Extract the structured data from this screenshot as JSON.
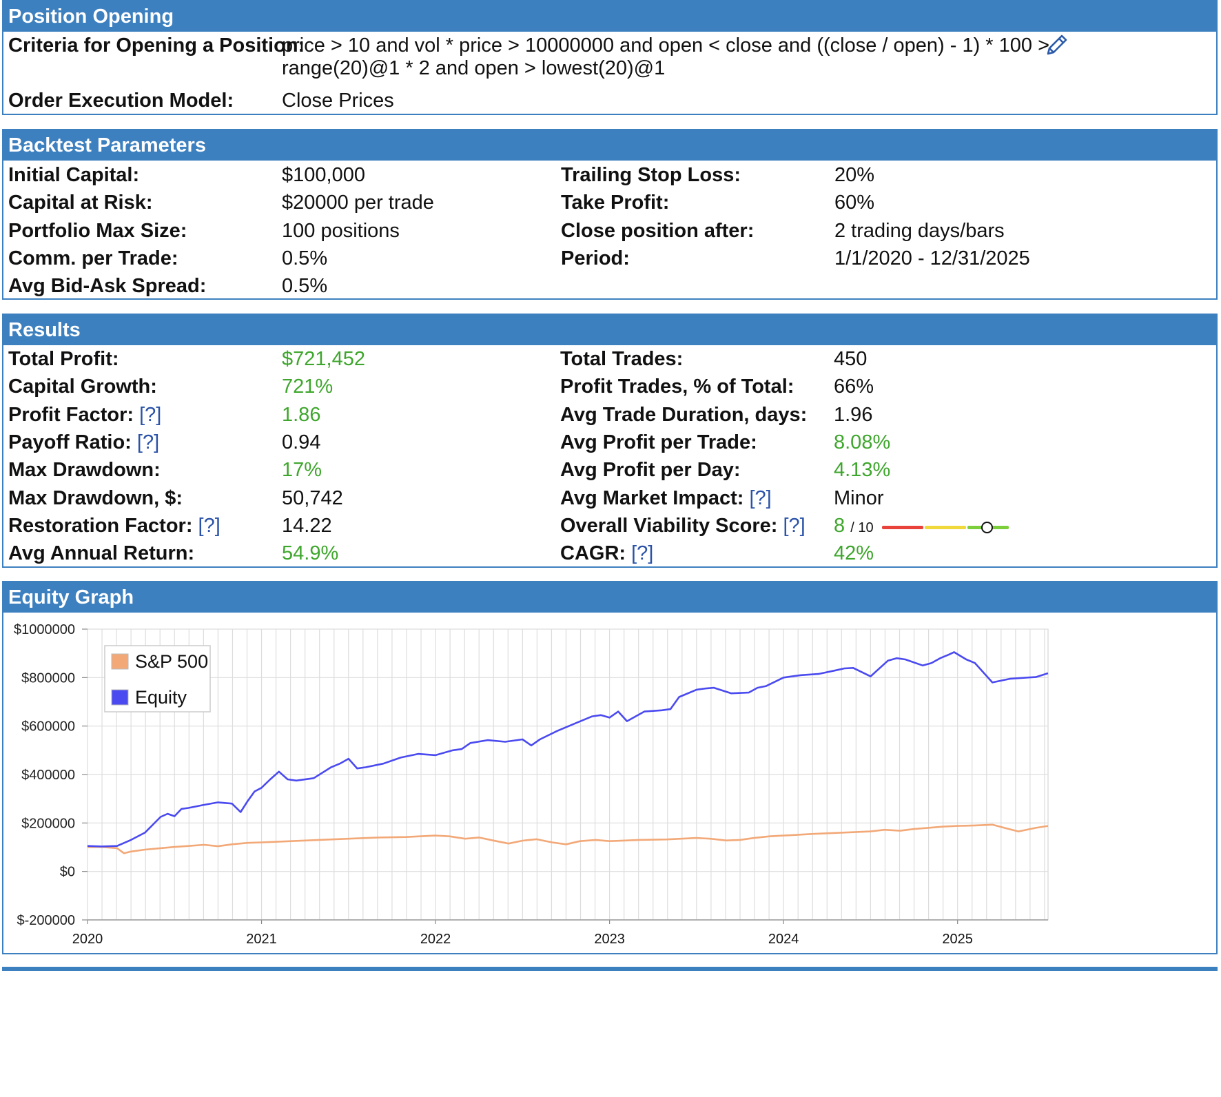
{
  "position_opening": {
    "title": "Position Opening",
    "criteria_label": "Criteria for Opening a Position:",
    "criteria_line1": "price > 10 and vol * price > 10000000 and open < close and ((close / open) - 1) * 100 >",
    "criteria_line2": "range(20)@1 * 2 and open > lowest(20)@1",
    "execution_label": "Order Execution Model:",
    "execution_value": "Close Prices",
    "edit_icon": "pencil-icon"
  },
  "backtest": {
    "title": "Backtest Parameters",
    "left": [
      {
        "label": "Initial Capital:",
        "value": "$100,000"
      },
      {
        "label": "Capital at Risk:",
        "value": "$20000 per trade"
      },
      {
        "label": "Portfolio Max Size:",
        "value": "100 positions"
      },
      {
        "label": "Comm. per Trade:",
        "value": "0.5%"
      },
      {
        "label": "Avg Bid-Ask Spread:",
        "value": "0.5%"
      }
    ],
    "right": [
      {
        "label": "Trailing Stop Loss:",
        "value": "20%"
      },
      {
        "label": "Take Profit:",
        "value": "60%"
      },
      {
        "label": "Close position after:",
        "value": "2 trading days/bars"
      },
      {
        "label": "Period:",
        "value": "1/1/2020 - 12/31/2025"
      }
    ]
  },
  "results": {
    "title": "Results",
    "help_text": "[?]",
    "left": [
      {
        "label": "Total Profit:",
        "value": "$721,452",
        "green": true,
        "help": false
      },
      {
        "label": "Capital Growth:",
        "value": "721%",
        "green": true,
        "help": false
      },
      {
        "label": "Profit Factor:",
        "value": "1.86",
        "green": true,
        "help": true
      },
      {
        "label": "Payoff Ratio:",
        "value": "0.94",
        "green": false,
        "help": true
      },
      {
        "label": "Max Drawdown:",
        "value": "17%",
        "green": true,
        "help": false
      },
      {
        "label": "Max Drawdown, $:",
        "value": "50,742",
        "green": false,
        "help": false
      },
      {
        "label": "Restoration Factor:",
        "value": "14.22",
        "green": false,
        "help": true
      },
      {
        "label": "Avg Annual Return:",
        "value": "54.9%",
        "green": true,
        "help": false
      }
    ],
    "right": [
      {
        "label": "Total Trades:",
        "value": "450",
        "green": false,
        "help": false
      },
      {
        "label": "Profit Trades, % of Total:",
        "value": "66%",
        "green": false,
        "help": false
      },
      {
        "label": "Avg Trade Duration, days:",
        "value": "1.96",
        "green": false,
        "help": false
      },
      {
        "label": "Avg Profit per Trade:",
        "value": "8.08%",
        "green": true,
        "help": false
      },
      {
        "label": "Avg Profit per Day:",
        "value": "4.13%",
        "green": true,
        "help": false
      },
      {
        "label": "Avg Market Impact:",
        "value": "Minor",
        "green": false,
        "help": true
      },
      {
        "label": "Overall Viability Score:",
        "value": "8",
        "green": true,
        "help": true,
        "suffix": "/ 10",
        "score": 8,
        "score_max": 10
      },
      {
        "label": "CAGR:",
        "value": "42%",
        "green": true,
        "help": true
      }
    ],
    "score_colors": [
      "#e8423a",
      "#f0d93a",
      "#7ccf3a"
    ]
  },
  "equity": {
    "title": "Equity Graph"
  },
  "chart_data": {
    "type": "line",
    "title": "",
    "xlabel": "",
    "ylabel": "",
    "ylim": [
      -200000,
      1000000
    ],
    "xlim": [
      2020.0,
      2025.52
    ],
    "yticks": [
      "$1000000",
      "$800000",
      "$600000",
      "$400000",
      "$200000",
      "$0",
      "$-200000"
    ],
    "ytick_values": [
      1000000,
      800000,
      600000,
      400000,
      200000,
      0,
      -200000
    ],
    "xticks": [
      "2020",
      "2021",
      "2022",
      "2023",
      "2024",
      "2025"
    ],
    "xtick_values": [
      2020,
      2021,
      2022,
      2023,
      2024,
      2025
    ],
    "legend_position": "top-left",
    "grid": true,
    "series": [
      {
        "name": "S&P 500",
        "color": "#f2a877",
        "x": [
          2020.0,
          2020.08,
          2020.17,
          2020.21,
          2020.25,
          2020.33,
          2020.42,
          2020.5,
          2020.58,
          2020.67,
          2020.75,
          2020.83,
          2020.92,
          2021.0,
          2021.17,
          2021.33,
          2021.5,
          2021.67,
          2021.83,
          2022.0,
          2022.08,
          2022.17,
          2022.25,
          2022.33,
          2022.42,
          2022.5,
          2022.58,
          2022.67,
          2022.75,
          2022.83,
          2022.92,
          2023.0,
          2023.17,
          2023.33,
          2023.5,
          2023.58,
          2023.67,
          2023.75,
          2023.83,
          2023.92,
          2024.0,
          2024.17,
          2024.33,
          2024.5,
          2024.58,
          2024.67,
          2024.75,
          2024.83,
          2024.92,
          2025.0,
          2025.1,
          2025.2,
          2025.28,
          2025.35,
          2025.45,
          2025.52
        ],
        "y": [
          100000,
          101000,
          96000,
          75000,
          82000,
          90000,
          96000,
          101000,
          105000,
          110000,
          104000,
          112000,
          118000,
          120000,
          125000,
          130000,
          135000,
          140000,
          142000,
          148000,
          145000,
          135000,
          140000,
          128000,
          115000,
          127000,
          133000,
          120000,
          112000,
          125000,
          130000,
          125000,
          130000,
          132000,
          138000,
          135000,
          128000,
          130000,
          138000,
          145000,
          148000,
          155000,
          160000,
          165000,
          172000,
          168000,
          175000,
          180000,
          185000,
          188000,
          190000,
          193000,
          178000,
          165000,
          180000,
          188000
        ]
      },
      {
        "name": "Equity",
        "color": "#4a4af0",
        "x": [
          2020.0,
          2020.08,
          2020.17,
          2020.25,
          2020.33,
          2020.42,
          2020.46,
          2020.5,
          2020.54,
          2020.58,
          2020.67,
          2020.75,
          2020.83,
          2020.88,
          2020.92,
          2020.96,
          2021.0,
          2021.05,
          2021.1,
          2021.15,
          2021.2,
          2021.3,
          2021.4,
          2021.45,
          2021.5,
          2021.55,
          2021.6,
          2021.7,
          2021.8,
          2021.9,
          2022.0,
          2022.1,
          2022.15,
          2022.2,
          2022.3,
          2022.4,
          2022.5,
          2022.55,
          2022.6,
          2022.7,
          2022.8,
          2022.9,
          2022.95,
          2023.0,
          2023.05,
          2023.1,
          2023.2,
          2023.3,
          2023.35,
          2023.4,
          2023.5,
          2023.55,
          2023.6,
          2023.7,
          2023.8,
          2023.85,
          2023.9,
          2024.0,
          2024.1,
          2024.2,
          2024.3,
          2024.35,
          2024.4,
          2024.5,
          2024.6,
          2024.65,
          2024.7,
          2024.8,
          2024.85,
          2024.9,
          2024.95,
          2024.98,
          2025.05,
          2025.1,
          2025.2,
          2025.3,
          2025.4,
          2025.45,
          2025.52
        ],
        "y": [
          105000,
          103000,
          105000,
          130000,
          160000,
          225000,
          238000,
          228000,
          258000,
          262000,
          275000,
          285000,
          280000,
          245000,
          290000,
          330000,
          345000,
          380000,
          412000,
          380000,
          375000,
          385000,
          430000,
          445000,
          465000,
          425000,
          430000,
          445000,
          470000,
          485000,
          480000,
          500000,
          505000,
          530000,
          542000,
          535000,
          545000,
          520000,
          545000,
          580000,
          610000,
          640000,
          645000,
          635000,
          660000,
          620000,
          660000,
          665000,
          670000,
          720000,
          750000,
          755000,
          758000,
          735000,
          738000,
          758000,
          765000,
          800000,
          810000,
          815000,
          830000,
          838000,
          840000,
          805000,
          870000,
          880000,
          875000,
          850000,
          860000,
          880000,
          895000,
          905000,
          875000,
          860000,
          780000,
          795000,
          800000,
          802000,
          818000
        ]
      }
    ]
  }
}
